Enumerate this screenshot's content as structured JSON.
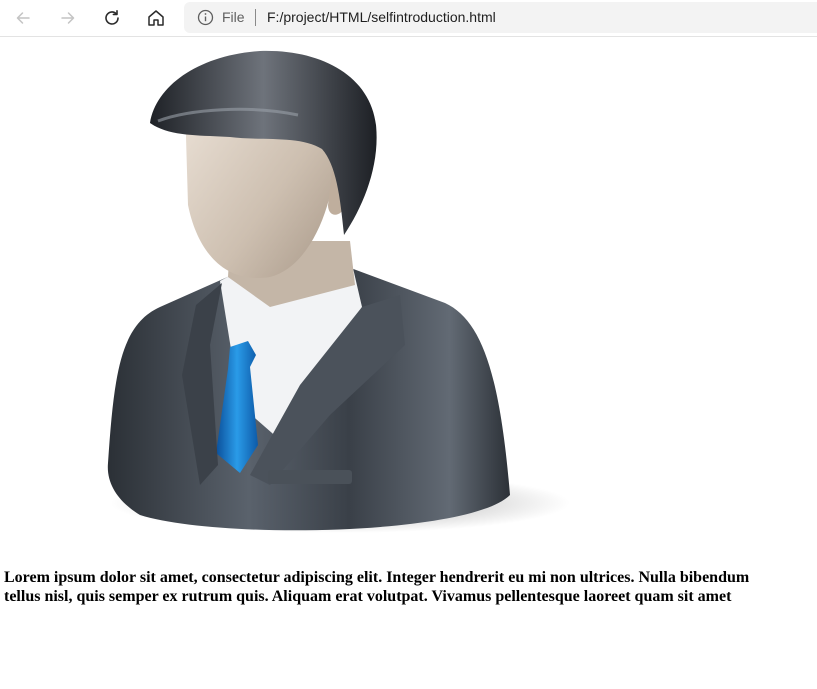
{
  "browser": {
    "url_scheme": "File",
    "url": "F:/project/HTML/selfintroduction.html",
    "icons": [
      "back-arrow-icon",
      "forward-arrow-icon",
      "refresh-icon",
      "home-icon",
      "info-icon"
    ]
  },
  "page": {
    "paragraph_lines": [
      "Lorem ipsum dolor sit amet, consectetur adipiscing elit. Integer hendrerit eu mi non ultrices. Nulla bibendum",
      "tellus nisl, quis semper ex rutrum quis. Aliquam erat volutpat. Vivamus pellentesque laoreet quam sit amet"
    ],
    "image": {
      "subject": "user-avatar-businessman",
      "colors": {
        "suit": "#3c434c",
        "shirt": "#f2f3f5",
        "tie": "#1f7fd0",
        "face": "#d6c9bb",
        "hair": "#2a2d33"
      }
    }
  }
}
